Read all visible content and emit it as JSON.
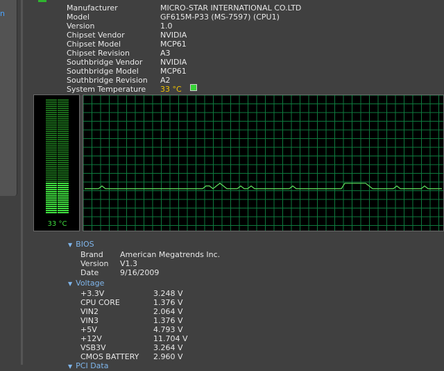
{
  "left_panel": {
    "partial_text": "n"
  },
  "motherboard": {
    "rows": [
      {
        "label": "Manufacturer",
        "value": "MICRO-STAR INTERNATIONAL CO.LTD"
      },
      {
        "label": "Model",
        "value": "GF615M-P33 (MS-7597) (CPU1)"
      },
      {
        "label": "Version",
        "value": "1.0"
      },
      {
        "label": "Chipset Vendor",
        "value": "NVIDIA"
      },
      {
        "label": "Chipset Model",
        "value": "MCP61"
      },
      {
        "label": "Chipset Revision",
        "value": "A3"
      },
      {
        "label": "Southbridge Vendor",
        "value": "NVIDIA"
      },
      {
        "label": "Southbridge Model",
        "value": "MCP61"
      },
      {
        "label": "Southbridge Revision",
        "value": "A2"
      }
    ],
    "temperature": {
      "label": "System Temperature",
      "value": "33 °C",
      "color": "#f2c200"
    }
  },
  "temp_meter": {
    "label": "33 °C",
    "level_fraction": 0.28,
    "lit_color": "#3fe03f",
    "dim_color": "#1a6a1a"
  },
  "temp_graph": {
    "line_color": "#5ee05e",
    "grid_color": "#0e7a3e",
    "series": [
      0.31,
      0.31,
      0.31,
      0.31,
      0.31,
      0.33,
      0.31,
      0.31,
      0.31,
      0.31,
      0.31,
      0.31,
      0.31,
      0.31,
      0.31,
      0.31,
      0.31,
      0.31,
      0.31,
      0.31,
      0.31,
      0.31,
      0.31,
      0.31,
      0.31,
      0.31,
      0.31,
      0.31,
      0.31,
      0.31,
      0.31,
      0.31,
      0.31,
      0.31,
      0.31,
      0.33,
      0.33,
      0.31,
      0.33,
      0.35,
      0.33,
      0.31,
      0.31,
      0.31,
      0.31,
      0.33,
      0.31,
      0.31,
      0.33,
      0.31,
      0.31,
      0.31,
      0.31,
      0.31,
      0.31,
      0.31,
      0.31,
      0.31,
      0.31,
      0.31,
      0.33,
      0.31,
      0.31,
      0.31,
      0.31,
      0.31,
      0.31,
      0.31,
      0.31,
      0.31,
      0.31,
      0.31,
      0.31,
      0.31,
      0.31,
      0.35,
      0.35,
      0.35,
      0.35,
      0.35,
      0.35,
      0.35,
      0.33,
      0.31,
      0.31,
      0.31,
      0.31,
      0.31,
      0.31,
      0.31,
      0.33,
      0.31,
      0.31,
      0.31,
      0.31,
      0.31,
      0.31,
      0.31,
      0.33,
      0.31,
      0.31,
      0.31,
      0.31,
      0.31
    ]
  },
  "bios": {
    "title": "BIOS",
    "rows": [
      {
        "label": "Brand",
        "value": "American Megatrends Inc."
      },
      {
        "label": "Version",
        "value": "V1.3"
      },
      {
        "label": "Date",
        "value": "9/16/2009"
      }
    ]
  },
  "voltage": {
    "title": "Voltage",
    "rows": [
      {
        "label": "+3.3V",
        "value": "3.248 V"
      },
      {
        "label": "CPU CORE",
        "value": "1.376 V"
      },
      {
        "label": "VIN2",
        "value": "2.064 V"
      },
      {
        "label": "VIN3",
        "value": "1.376 V"
      },
      {
        "label": "+5V",
        "value": "4.793 V"
      },
      {
        "label": "+12V",
        "value": "11.704 V"
      },
      {
        "label": "VSB3V",
        "value": "3.264 V"
      },
      {
        "label": "CMOS BATTERY",
        "value": "2.960 V"
      }
    ]
  },
  "partial_section": {
    "title": "PCI Data"
  }
}
